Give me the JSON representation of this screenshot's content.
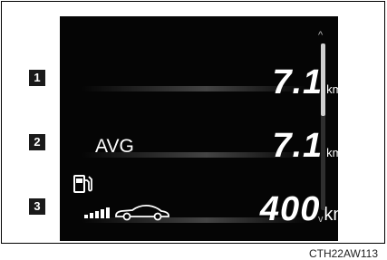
{
  "rows": [
    {
      "badge": "1",
      "value": "7.1",
      "unit": "km/l"
    },
    {
      "badge": "2",
      "label": "AVG",
      "value": "7.1",
      "unit": "km/l"
    },
    {
      "badge": "3",
      "value": "400",
      "unit": "km"
    }
  ],
  "icons": {
    "fuel": "fuel-pump-icon",
    "car": "car-icon",
    "bars": "signal-bars-icon"
  },
  "figure_code": "CTH22AW113",
  "colors": {
    "screen": "#050505",
    "text": "#ffffff",
    "badge": "#1a1a1a"
  }
}
